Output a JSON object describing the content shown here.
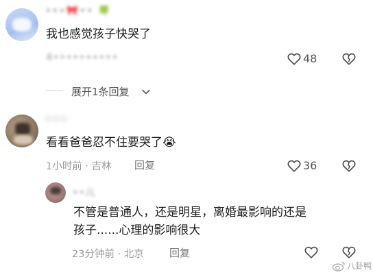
{
  "comments": [
    {
      "username": "•••🎀•• 🍀",
      "text": "我也感觉孩子快哭了",
      "meta": "4••••••••••",
      "likes": "48"
    },
    {
      "username": "•••",
      "text": "看看爸爸忍不住要哭了😭",
      "meta": "1小时前 · 吉林",
      "reply_label": "回复",
      "likes": "36"
    }
  ],
  "expand_replies": {
    "label": "展开1条回复"
  },
  "reply": {
    "username": "••儿",
    "text_line1": "不管是普通人，还是明星，离婚最影响的还是",
    "text_line2": "孩子......心理的影响很大",
    "meta": "23分钟前 · 北京",
    "reply_label": "回复"
  },
  "watermark": {
    "text": "八卦鸭"
  },
  "icons": {
    "like": "heart-outline-icon",
    "dislike": "broken-heart-icon",
    "expand": "chevron-down-icon"
  },
  "colors": {
    "text": "#1b1b1b",
    "meta": "#9a9a9a",
    "icon": "#4a4a4a"
  }
}
